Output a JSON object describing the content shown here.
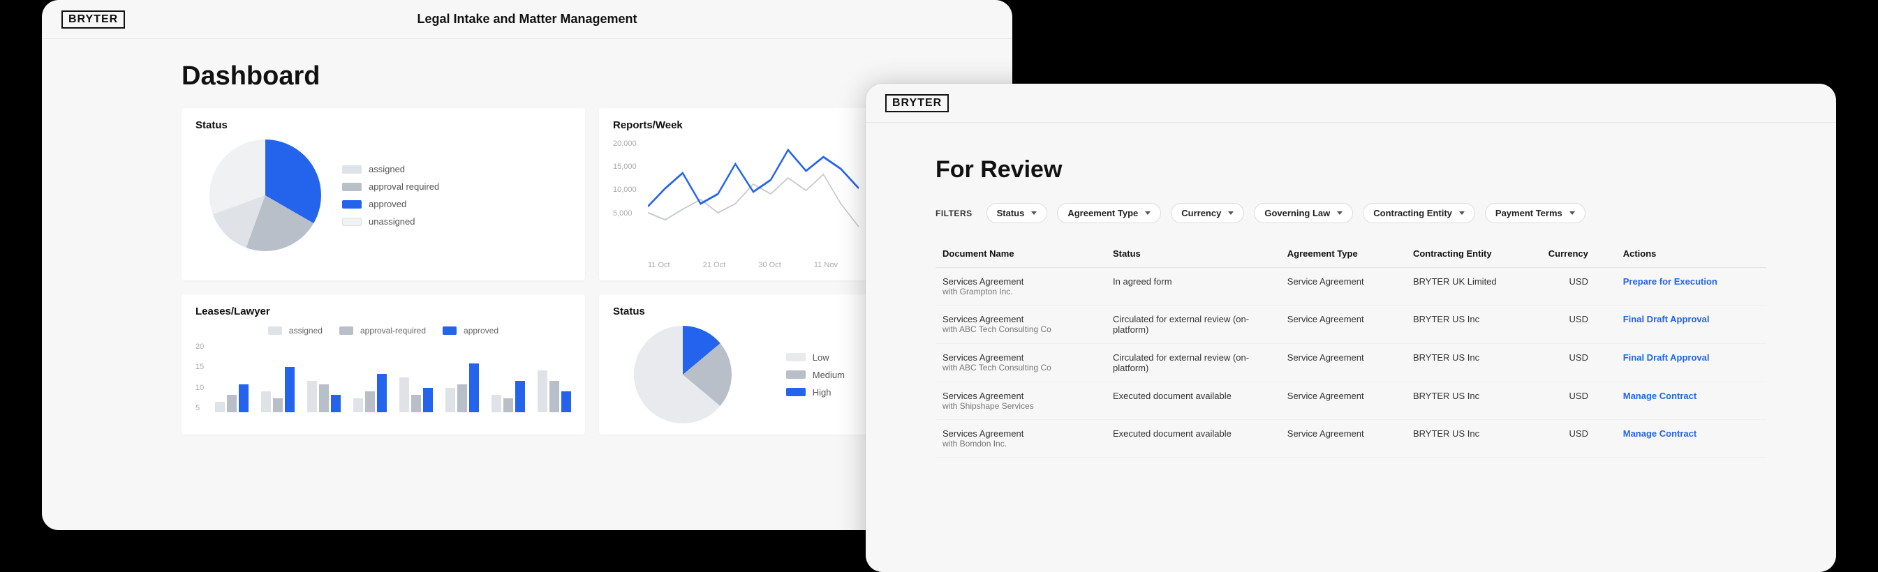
{
  "colors": {
    "blue": "#2463eb",
    "grey3": "#b8bfc9",
    "grey2": "#dfe3e8",
    "grey1": "#f0f1f3"
  },
  "window1": {
    "logo": "BRYTER",
    "title": "Legal Intake and Matter Management",
    "heading": "Dashboard",
    "cards": {
      "status": {
        "title": "Status",
        "legend": [
          "assigned",
          "approval required",
          "approved",
          "unassigned"
        ]
      },
      "reports": {
        "title": "Reports/Week"
      },
      "leases": {
        "title": "Leases/Lawyer",
        "legend": [
          "assigned",
          "approval-required",
          "approved"
        ]
      },
      "status2": {
        "title": "Status",
        "legend": [
          "Low",
          "Medium",
          "High"
        ]
      }
    }
  },
  "window2": {
    "logo": "BRYTER",
    "heading": "For Review",
    "filters_label": "FILTERS",
    "filters": [
      "Status",
      "Agreement Type",
      "Currency",
      "Governing Law",
      "Contracting Entity",
      "Payment Terms"
    ],
    "columns": [
      "Document Name",
      "Status",
      "Agreement Type",
      "Contracting Entity",
      "Currency",
      "Actions"
    ],
    "rows": [
      {
        "name": "Services Agreement",
        "sub": "with Grampton Inc.",
        "status": "In agreed form",
        "type": "Service Agreement",
        "entity": "BRYTER UK Limited",
        "currency": "USD",
        "action": "Prepare for Execution"
      },
      {
        "name": "Services Agreement",
        "sub": "with ABC Tech Consulting Co",
        "status": "Circulated for external review (on-platform)",
        "type": "Service Agreement",
        "entity": "BRYTER US Inc",
        "currency": "USD",
        "action": "Final Draft Approval"
      },
      {
        "name": "Services Agreement",
        "sub": "with ABC Tech Consulting Co",
        "status": "Circulated for external review (on-platform)",
        "type": "Service Agreement",
        "entity": "BRYTER US Inc",
        "currency": "USD",
        "action": "Final Draft Approval"
      },
      {
        "name": "Services Agreement",
        "sub": "with Shipshape Services",
        "status": "Executed document available",
        "type": "Service Agreement",
        "entity": "BRYTER US Inc",
        "currency": "USD",
        "action": "Manage Contract"
      },
      {
        "name": "Services Agreement",
        "sub": "with Bomdon Inc.",
        "status": "Executed document available",
        "type": "Service Agreement",
        "entity": "BRYTER US Inc",
        "currency": "USD",
        "action": "Manage Contract"
      }
    ]
  },
  "chart_data": [
    {
      "type": "pie",
      "title": "Status",
      "categories": [
        "assigned",
        "approval required",
        "approved",
        "unassigned"
      ],
      "values": [
        15,
        20,
        35,
        30
      ]
    },
    {
      "type": "line",
      "title": "Reports/Week",
      "x": [
        "11 Oct",
        "21 Oct",
        "30 Oct",
        "11 Nov"
      ],
      "ylim": [
        5000,
        20000
      ],
      "ytick_labels": [
        "20,000",
        "15,000",
        "10,000",
        "5,000"
      ],
      "series": [
        {
          "name": "series-blue",
          "color": "#2463eb",
          "values": [
            9000,
            12000,
            14500,
            9500,
            11000,
            16000,
            11500,
            13500,
            18500,
            15000,
            17500,
            15500,
            12500
          ]
        },
        {
          "name": "series-grey",
          "color": "#c6c9cf",
          "values": [
            8000,
            7000,
            9000,
            10500,
            8000,
            9500,
            12500,
            11000,
            13500,
            11500,
            14000,
            9500,
            6000
          ]
        }
      ]
    },
    {
      "type": "bar",
      "title": "Leases/Lawyer",
      "ylim": [
        0,
        20
      ],
      "ytick_labels": [
        "20",
        "15",
        "10",
        "5"
      ],
      "series": [
        {
          "name": "assigned",
          "color": "#dfe3e8",
          "values": [
            3,
            6,
            9,
            4,
            10,
            7,
            5,
            12
          ]
        },
        {
          "name": "approval-required",
          "color": "#b8bfc9",
          "values": [
            5,
            4,
            8,
            6,
            5,
            8,
            4,
            9
          ]
        },
        {
          "name": "approved",
          "color": "#2463eb",
          "values": [
            8,
            13,
            5,
            11,
            7,
            14,
            9,
            6
          ]
        }
      ]
    },
    {
      "type": "pie",
      "title": "Status",
      "categories": [
        "Low",
        "Medium",
        "High"
      ],
      "values": [
        60,
        25,
        15
      ]
    }
  ]
}
